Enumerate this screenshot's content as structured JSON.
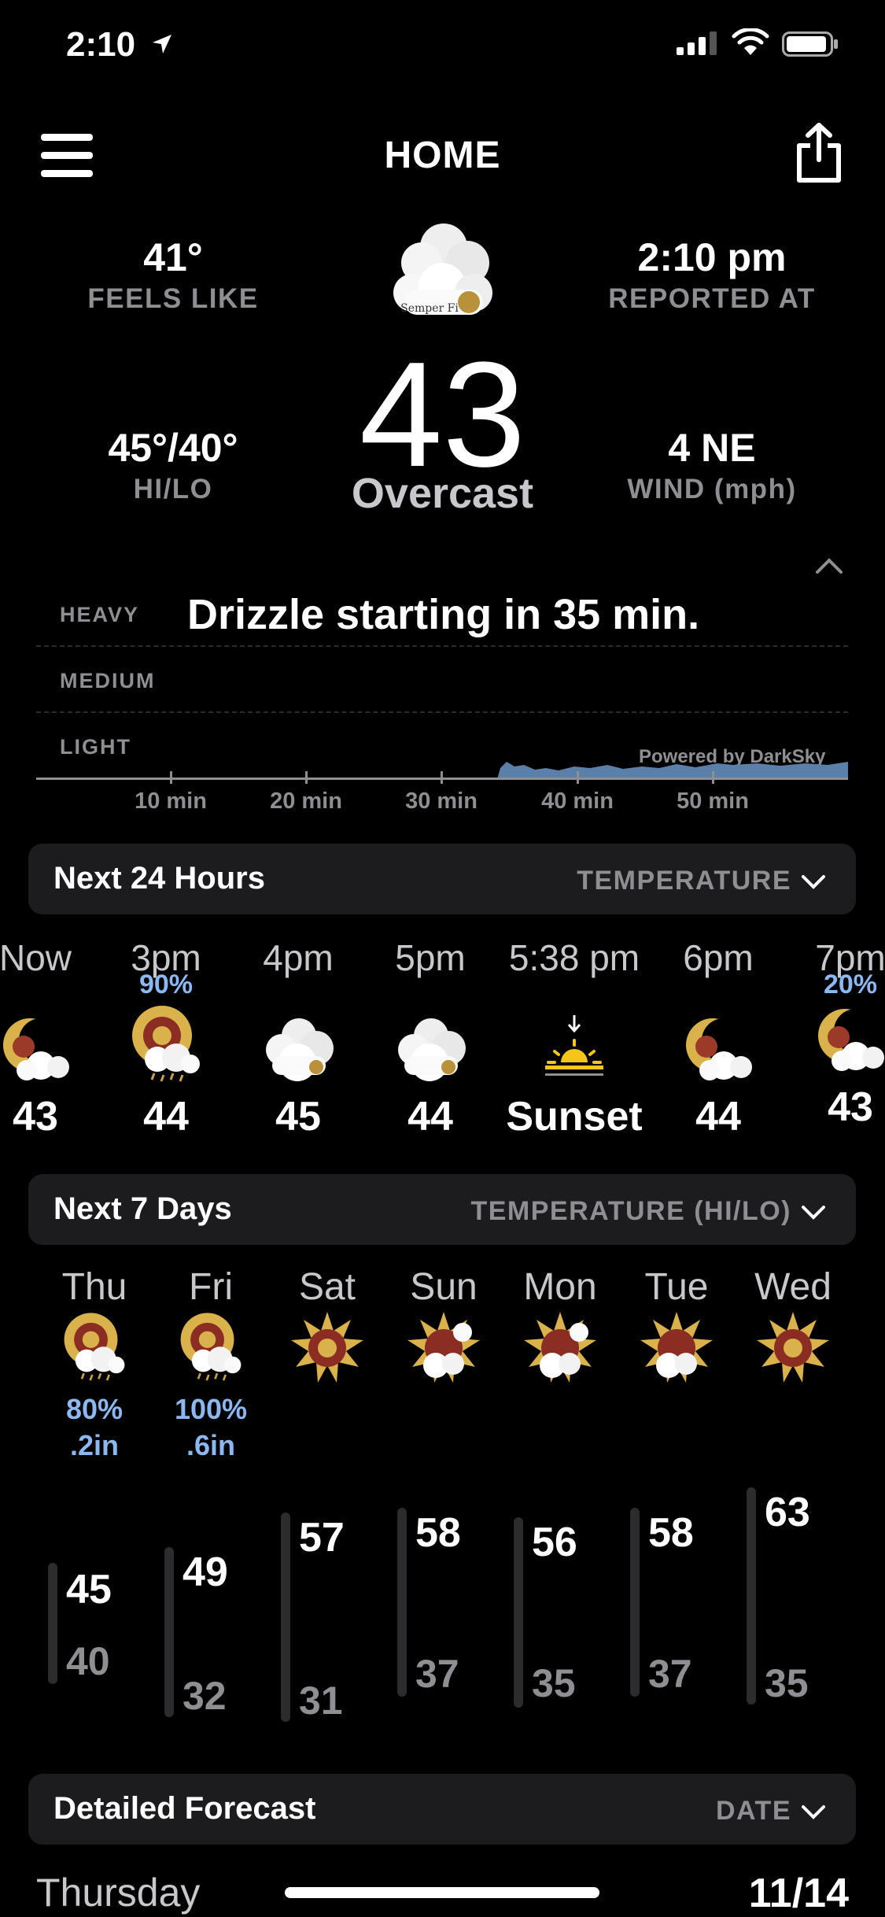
{
  "status": {
    "time": "2:10"
  },
  "header": {
    "title": "HOME"
  },
  "current": {
    "feels_like": "41°",
    "feels_like_label": "FEELS LIKE",
    "reported_at": "2:10 pm",
    "reported_at_label": "REPORTED AT",
    "temp": "43",
    "condition": "Overcast",
    "hilo": "45°/40°",
    "hilo_label": "HI/LO",
    "wind": "4 NE",
    "wind_label": "WIND (mph)",
    "icon_badge": "Semper Fi"
  },
  "precip": {
    "headline": "Drizzle starting in 35 min.",
    "levels": [
      "HEAVY",
      "MEDIUM",
      "LIGHT"
    ],
    "ticks": [
      "10 min",
      "20 min",
      "30 min",
      "40 min",
      "50 min"
    ],
    "powered_by": "Powered by DarkSky"
  },
  "hourly": {
    "title": "Next 24 Hours",
    "selector": "TEMPERATURE",
    "items": [
      {
        "time": "Now",
        "pct": "",
        "value": "43",
        "icon": "moon-clouds-icon"
      },
      {
        "time": "3pm",
        "pct": "90%",
        "value": "44",
        "icon": "sun-rain-icon"
      },
      {
        "time": "4pm",
        "pct": "",
        "value": "45",
        "icon": "cloud-icon"
      },
      {
        "time": "5pm",
        "pct": "",
        "value": "44",
        "icon": "cloud-icon"
      },
      {
        "time": "5:38 pm",
        "pct": "",
        "value": "Sunset",
        "icon": "sunset-icon"
      },
      {
        "time": "6pm",
        "pct": "",
        "value": "44",
        "icon": "moon-clouds-icon"
      },
      {
        "time": "7pm",
        "pct": "20%",
        "value": "43",
        "icon": "moon-clouds-icon"
      }
    ]
  },
  "daily": {
    "title": "Next 7 Days",
    "selector": "TEMPERATURE (HI/LO)",
    "items": [
      {
        "day": "Thu",
        "pct": "80%",
        "amt": ".2in",
        "hi": "45",
        "lo": "40",
        "icon": "sun-rain-icon"
      },
      {
        "day": "Fri",
        "pct": "100%",
        "amt": ".6in",
        "hi": "49",
        "lo": "32",
        "icon": "sun-rain-icon"
      },
      {
        "day": "Sat",
        "pct": "",
        "amt": "",
        "hi": "57",
        "lo": "31",
        "icon": "sun-icon"
      },
      {
        "day": "Sun",
        "pct": "",
        "amt": "",
        "hi": "58",
        "lo": "37",
        "icon": "sun-cloud-icon"
      },
      {
        "day": "Mon",
        "pct": "",
        "amt": "",
        "hi": "56",
        "lo": "35",
        "icon": "sun-cloud-icon"
      },
      {
        "day": "Tue",
        "pct": "",
        "amt": "",
        "hi": "58",
        "lo": "37",
        "icon": "sun-cloud-icon"
      },
      {
        "day": "Wed",
        "pct": "",
        "amt": "",
        "hi": "63",
        "lo": "35",
        "icon": "sun-icon"
      }
    ]
  },
  "detailed": {
    "title": "Detailed Forecast",
    "selector": "DATE",
    "first_day": "Thursday",
    "first_date": "11/14"
  }
}
